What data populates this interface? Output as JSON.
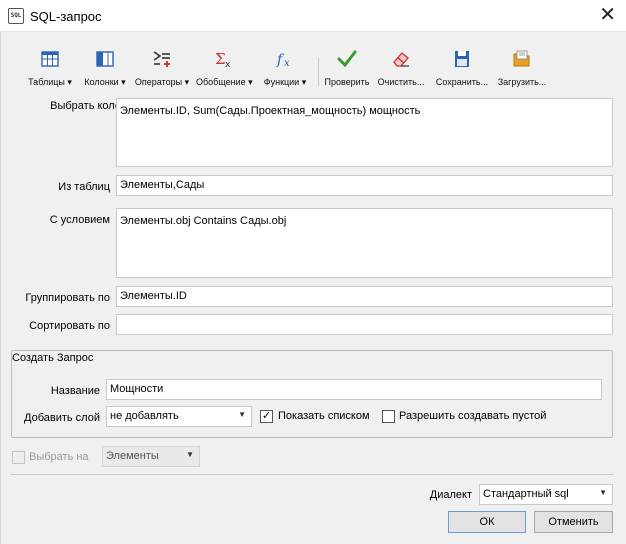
{
  "window": {
    "icon_text": "SQL",
    "title": "SQL-запрос"
  },
  "toolbar": {
    "tables": "Таблицы",
    "columns": "Колонки",
    "operators": "Операторы",
    "aggregate": "Обобщение",
    "functions": "Функции",
    "check": "Проверить",
    "clear": "Очистить...",
    "save": "Сохранить...",
    "load": "Загрузить..."
  },
  "form": {
    "select_columns_label": "Выбрать колонки",
    "select_columns_value": "Элементы.ID, Sum(Сады.Проектная_мощность) мощность",
    "from_tables_label": "Из таблиц",
    "from_tables_value": "Элементы,Сады",
    "where_label": "С условием",
    "where_value": "Элементы.obj Contains Сады.obj",
    "group_by_label": "Группировать по",
    "group_by_value": "Элементы.ID",
    "order_by_label": "Сортировать по",
    "order_by_value": ""
  },
  "create_query": {
    "group_title": "Создать Запрос",
    "name_label": "Название",
    "name_value": "Мощности",
    "add_layer_label": "Добавить слой",
    "add_layer_value": "не добавлять",
    "show_as_list_label": "Показать списком",
    "show_as_list_checked": true,
    "allow_empty_label": "Разрешить создавать пустой",
    "allow_empty_checked": false
  },
  "select_on": {
    "label": "Выбрать на",
    "value": "Элементы",
    "enabled": false
  },
  "dialect": {
    "label": "Диалект",
    "value": "Стандартный sql"
  },
  "buttons": {
    "ok": "ОК",
    "cancel": "Отменить"
  },
  "colors": {
    "check_green": "#3a9a2f",
    "sigma_red": "#c8322c",
    "fx_blue": "#2a64b8",
    "icon_yellow": "#e8a020"
  }
}
